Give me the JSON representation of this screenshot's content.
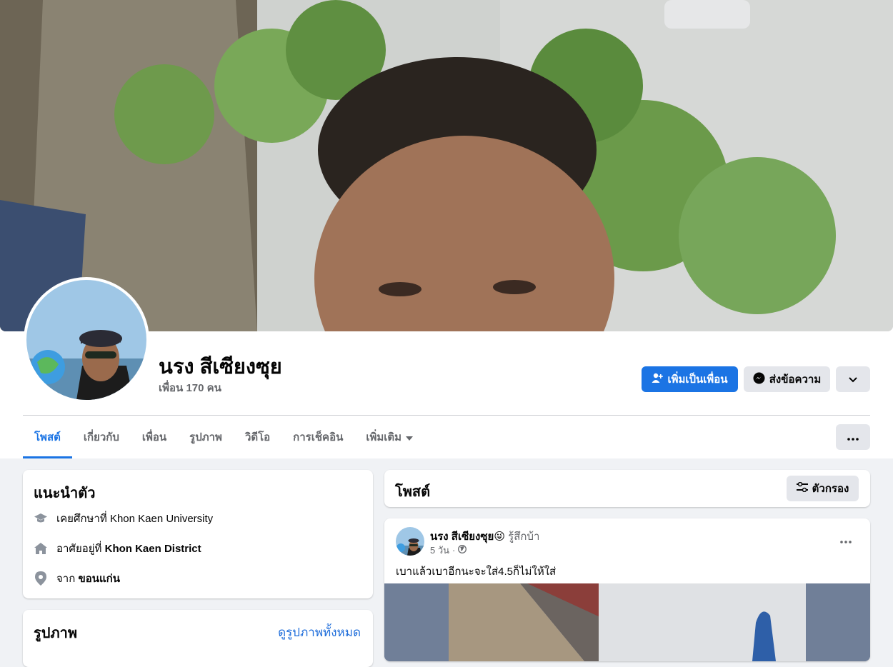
{
  "profile": {
    "name": "นรง สีเซียงซุย",
    "friends": "เพื่อน 170 คน"
  },
  "actions": {
    "add_friend": "เพิ่มเป็นเพื่อน",
    "message": "ส่งข้อความ"
  },
  "tabs": [
    {
      "label": "โพสต์"
    },
    {
      "label": "เกี่ยวกับ"
    },
    {
      "label": "เพื่อน"
    },
    {
      "label": "รูปภาพ"
    },
    {
      "label": "วิดีโอ"
    },
    {
      "label": "การเช็คอิน"
    },
    {
      "label": "เพิ่มเติม"
    }
  ],
  "intro": {
    "title": "แนะนำตัว",
    "education_prefix": "เคยศึกษาที่",
    "education": "Khon Kaen University",
    "lives_prefix": "อาศัยอยู่ที่",
    "lives": "Khon Kaen District",
    "from_prefix": "จาก",
    "from": "ขอนแก่น"
  },
  "photos": {
    "title": "รูปภาพ",
    "see_all": "ดูรูปภาพทั้งหมด"
  },
  "posts_header": {
    "title": "โพสต์",
    "filter": "ตัวกรอง"
  },
  "post": {
    "author": "นรง สีเซียงซุย",
    "emoji": "😜",
    "feeling": "รู้สึกบ้า",
    "time": "5 วัน",
    "dot": "·",
    "text": "เบาแล้วเบาอีกนะจะใส่4.5ก็ไม่ให้ใส่"
  },
  "colors": {
    "accent": "#1b74e4",
    "background": "#f0f2f5",
    "secondary_button": "#e4e6eb"
  }
}
